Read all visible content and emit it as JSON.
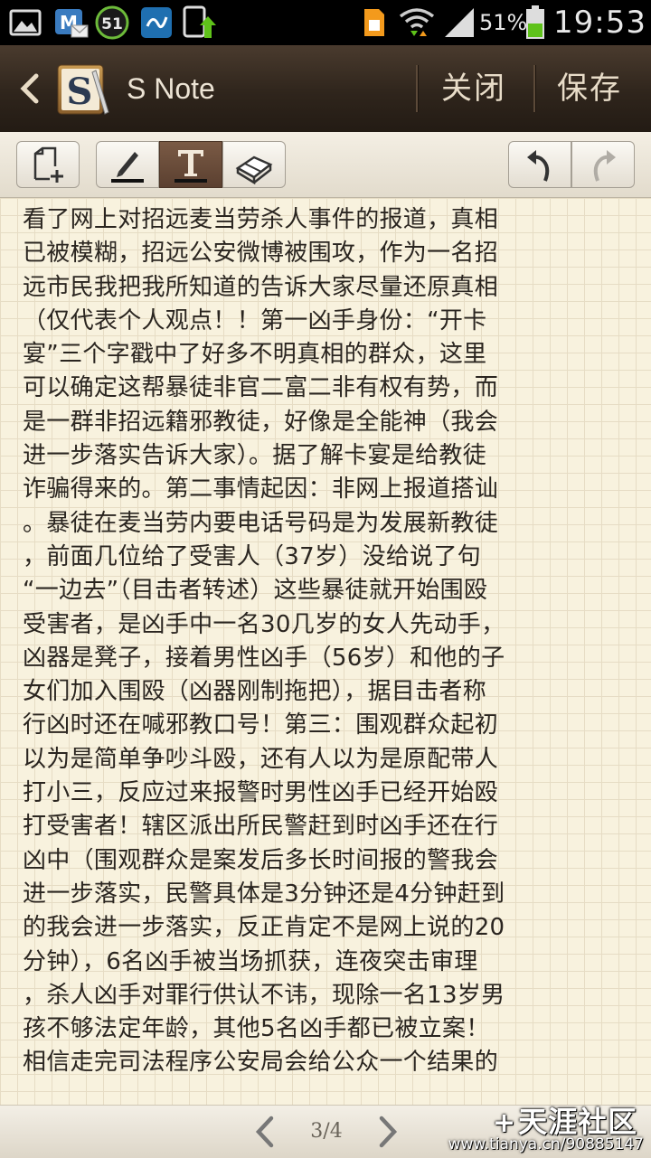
{
  "status_bar": {
    "battery_percent": "51%",
    "time": "19:53",
    "notification_badge": "51",
    "icons": [
      "gallery-icon",
      "mail-icon",
      "badge-51-icon",
      "sync-icon",
      "download-icon",
      "sim-icon",
      "wifi-icon",
      "signal-icon",
      "battery-icon"
    ],
    "battery_color": "#5fc21a"
  },
  "title_bar": {
    "app_name": "S Note",
    "close_label": "关闭",
    "save_label": "保存",
    "logo_letter": "S"
  },
  "toolbar": {
    "tools": [
      "add-page-icon",
      "pen-icon",
      "text-icon",
      "eraser-icon",
      "undo-icon",
      "redo-icon"
    ],
    "active_tool": "text",
    "active_color": "#6b4c3a"
  },
  "note": {
    "lines": [
      "看了网上对招远麦当劳杀人事件的报道，真相",
      "已被模糊，招远公安微博被围攻，作为一名招",
      "远市民我把我所知道的告诉大家尽量还原真相",
      "（仅代表个人观点！！第一凶手身份：“开卡",
      "宴”三个字戳中了好多不明真相的群众，这里",
      "可以确定这帮暴徒非官二富二非有权有势，而",
      "是一群非招远籍邪教徒，好像是全能神（我会",
      "进一步落实告诉大家）。据了解卡宴是给教徒",
      "诈骗得来的。第二事情起因：非网上报道搭讪",
      "。暴徒在麦当劳内要电话号码是为发展新教徒",
      "，前面几位给了受害人（37岁）没给说了句",
      "“一边去”（目击者转述）这些暴徒就开始围殴",
      "受害者，是凶手中一名30几岁的女人先动手，",
      "凶器是凳子，接着男性凶手（56岁）和他的子",
      "女们加入围殴（凶器刚制拖把），据目击者称",
      "行凶时还在喊邪教口号！第三：围观群众起初",
      "以为是简单争吵斗殴，还有人以为是原配带人",
      "打小三，反应过来报警时男性凶手已经开始殴",
      "打受害者！辖区派出所民警赶到时凶手还在行",
      "凶中（围观群众是案发后多长时间报的警我会",
      "进一步落实，民警具体是3分钟还是4分钟赶到",
      "的我会进一步落实，反正肯定不是网上说的20",
      "分钟），6名凶手被当场抓获，连夜突击审理",
      "，杀人凶手对罪行供认不讳，现除一名13岁男",
      "孩不够法定年龄，其他5名凶手都已被立案！",
      "相信走完司法程序公安局会给公众一个结果的"
    ]
  },
  "bottom_bar": {
    "page_indicator": "3/4"
  },
  "watermark": {
    "logo_text": "天涯社区",
    "url": "www.tianya.cn/90885147"
  }
}
